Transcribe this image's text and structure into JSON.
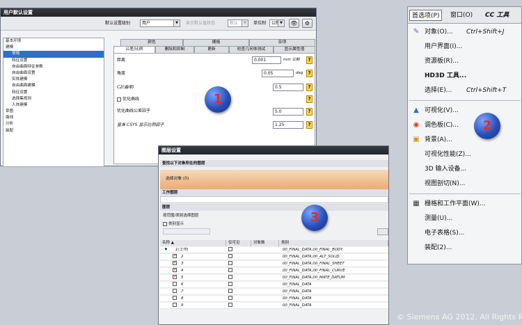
{
  "w1": {
    "title": "用户默认设置",
    "toolbar": {
      "level_label": "默认设置级别",
      "level_value": "用户",
      "ghost_label": "显示默认值状态",
      "ghost_value": "默认",
      "unit_label": "单位制",
      "unit_value": "公制"
    },
    "tree": [
      "基本环境",
      "建模",
      "常规",
      "特征设置",
      "自由曲面特征参数",
      "自由曲面设置",
      "实体建模",
      "自由曲面建模",
      "特征设置",
      "选择集规则",
      "人体建模",
      "草图",
      "曲线",
      "分析",
      "装配"
    ],
    "tabs_top": [
      "颜色",
      "栅格",
      "杂项"
    ],
    "tabs": [
      "公差/比例",
      "删除和抑制",
      "更新",
      "检查几何体测试",
      "显示属性值"
    ],
    "fields": {
      "dist_label": "距离",
      "dist_value": "0.001",
      "dist_unit": "mm 公制",
      "angle_label": "角度",
      "angle_value": "0.05",
      "angle_unit": "deg",
      "c2_label": "C2(曲率)",
      "c2_value": "0.5",
      "opt_label": "优化曲线",
      "optfac_label": "优化曲线公差因子",
      "optfac_value": "5.0",
      "csys_label": "基准 CSYS 显示比例因子",
      "csys_value": "1.25"
    },
    "badge": "1"
  },
  "w2": {
    "menubar": [
      "首选项(P)",
      "窗口(O)",
      "CC 工具"
    ],
    "items": [
      {
        "icon": "object-icon",
        "label": "对象(O)...",
        "shortcut": "Ctrl+Shift+J"
      },
      {
        "icon": "",
        "label": "用户界面(I)...",
        "shortcut": ""
      },
      {
        "icon": "",
        "label": "资源板(R)...",
        "shortcut": ""
      },
      {
        "icon": "",
        "label": "HD3D 工具...",
        "shortcut": ""
      },
      {
        "icon": "",
        "label": "选择(E)...",
        "shortcut": "Ctrl+Shift+T"
      },
      {
        "icon": "visualization-icon",
        "label": "可视化(V)...",
        "shortcut": ""
      },
      {
        "icon": "palette-icon",
        "label": "调色板(C)...",
        "shortcut": ""
      },
      {
        "icon": "background-icon",
        "label": "背景(A)...",
        "shortcut": ""
      },
      {
        "icon": "",
        "label": "可视化性能(Z)...",
        "shortcut": ""
      },
      {
        "icon": "",
        "label": "3D 输入设备...",
        "shortcut": ""
      },
      {
        "icon": "",
        "label": "视图剖切(N)...",
        "shortcut": ""
      },
      {
        "icon": "grid-icon",
        "label": "栅格和工作平面(W)...",
        "shortcut": ""
      },
      {
        "icon": "",
        "label": "测量(U)...",
        "shortcut": ""
      },
      {
        "icon": "",
        "label": "电子表格(S)...",
        "shortcut": ""
      },
      {
        "icon": "",
        "label": "装配(2)...",
        "shortcut": ""
      }
    ],
    "badge": "2"
  },
  "w3": {
    "title": "图层设置",
    "sec1": "查找以下对象所在的图层",
    "select_obj": "选择对象 (0)",
    "sec2": "工作图层",
    "sec3": "图层",
    "filter_label": "按范围/类别选择图层",
    "show_label": "类别显示",
    "col_name": "名称 ▲",
    "col_visible": "仅可见",
    "col_count": "对象数",
    "col_category": "类别",
    "rows": [
      {
        "name": "1(工作)",
        "cat": "00_FINAL_DATA,00_FINAL_BODY",
        "checked": false,
        "work": true
      },
      {
        "name": "2",
        "cat": "00_FINAL_DATA,00_ALT_SOLID",
        "checked": true
      },
      {
        "name": "3",
        "cat": "00_FINAL_DATA,00_FINAL_SHEET",
        "checked": true
      },
      {
        "name": "4",
        "cat": "00_FINAL_DATA,00_FINAL_CURVE",
        "checked": true
      },
      {
        "name": "5",
        "cat": "00_FINAL_DATA,00_MATE_DATUM",
        "checked": true
      },
      {
        "name": "6",
        "cat": "00_FINAL_DATA",
        "checked": false
      },
      {
        "name": "7",
        "cat": "00_FINAL_DATA",
        "checked": false
      },
      {
        "name": "8",
        "cat": "00_FINAL_DATA",
        "checked": false
      },
      {
        "name": "9",
        "cat": "00_FINAL_DATA",
        "checked": false
      }
    ],
    "badge": "3"
  },
  "copyright": "© Siemens AG 2012. All Rights R"
}
